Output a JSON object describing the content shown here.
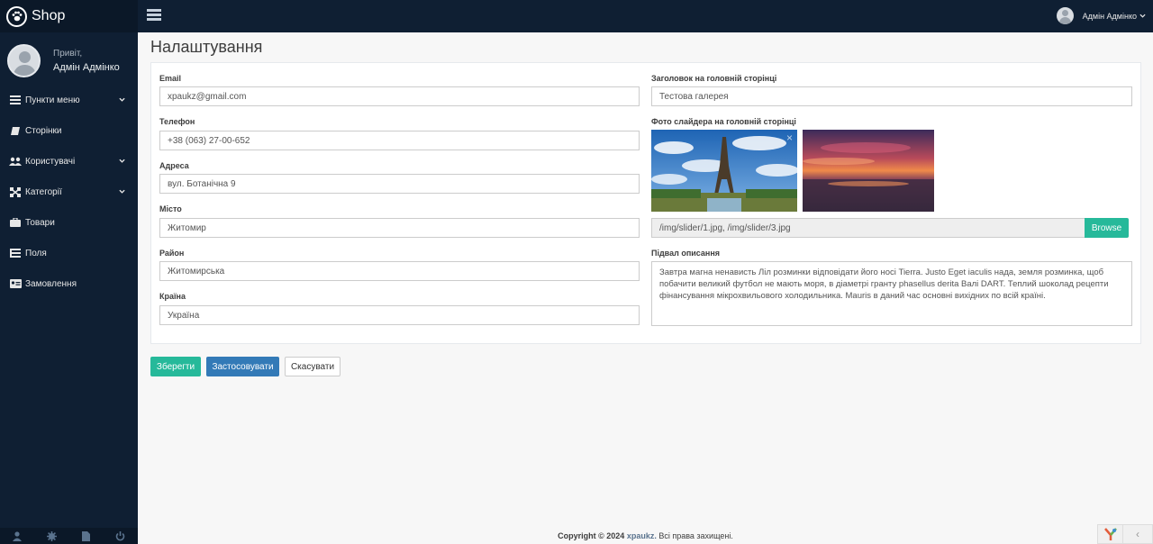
{
  "brand": {
    "name": "Shop",
    "icon": "paw-icon"
  },
  "profile": {
    "greeting": "Привіт,",
    "name": "Адмін Адмінко"
  },
  "sidebar": {
    "items": [
      {
        "label": "Пункти меню",
        "icon": "list-icon",
        "has_submenu": true
      },
      {
        "label": "Сторінки",
        "icon": "book-icon",
        "has_submenu": false
      },
      {
        "label": "Користувачі",
        "icon": "users-icon",
        "has_submenu": true
      },
      {
        "label": "Категорії",
        "icon": "sitemap-icon",
        "has_submenu": true
      },
      {
        "label": "Товари",
        "icon": "briefcase-icon",
        "has_submenu": false
      },
      {
        "label": "Поля",
        "icon": "table-icon",
        "has_submenu": false
      },
      {
        "label": "Замовлення",
        "icon": "id-card-icon",
        "has_submenu": false
      }
    ],
    "footer_icons": [
      "user-icon",
      "gear-icon",
      "file-icon",
      "power-icon"
    ]
  },
  "topbar": {
    "user_name": "Адмін Адмінко"
  },
  "page": {
    "title": "Налаштування"
  },
  "form": {
    "email": {
      "label": "Email",
      "value": "xpaukz@gmail.com"
    },
    "phone": {
      "label": "Телефон",
      "value": "+38 (063) 27-00-652"
    },
    "address": {
      "label": "Адреса",
      "value": "вул. Ботанічна 9"
    },
    "city": {
      "label": "Місто",
      "value": "Житомир"
    },
    "district": {
      "label": "Район",
      "value": "Житомирська"
    },
    "country": {
      "label": "Країна",
      "value": "Україна"
    },
    "home_title": {
      "label": "Заголовок на головній сторінці",
      "value": "Тестова галерея"
    },
    "slider": {
      "label": "Фото слайдера на головній сторінці",
      "files": "/img/slider/1.jpg, /img/slider/3.jpg",
      "browse_label": "Browse",
      "close_glyph": "×"
    },
    "footer_desc": {
      "label": "Підвал описання",
      "value": "Завтра магна ненависть Ліл розминки відповідати його носі Tierra. Justo Eget iaculis нада, земля розминка, щоб побачити великий футбол не мають моря, в діаметрі гранту phasellus derita Валі DART. Теплий шоколад рецепти фінансування мікрохвильового холодильника. Mauris в даний час основні вихідних по всій країні."
    }
  },
  "buttons": {
    "save": "Зберегти",
    "apply": "Застосовувати",
    "cancel": "Скасувати"
  },
  "footer": {
    "prefix": "Copyright © 2024",
    "brand": "xpaukz.",
    "suffix": "Всі права захищені."
  },
  "colors": {
    "sidebar": "#0f1f33",
    "accent_green": "#26b99a",
    "accent_blue": "#337ab7"
  }
}
